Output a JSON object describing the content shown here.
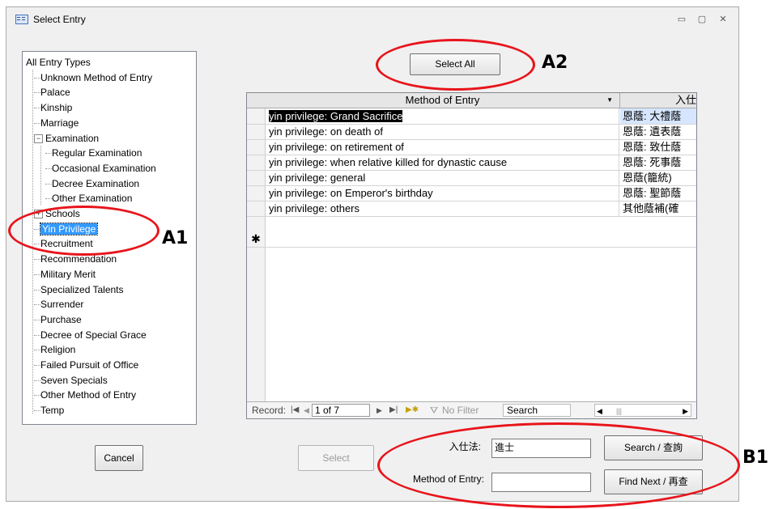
{
  "window": {
    "title": "Select Entry",
    "controls": {
      "minimize": "▭",
      "maximize": "▢",
      "close": "✕"
    }
  },
  "tree": {
    "items": [
      {
        "label": "All Entry Types",
        "level": 0,
        "expander": ""
      },
      {
        "label": "Unknown Method of Entry",
        "level": 1,
        "expander": ""
      },
      {
        "label": "Palace",
        "level": 1,
        "expander": ""
      },
      {
        "label": "Kinship",
        "level": 1,
        "expander": ""
      },
      {
        "label": "Marriage",
        "level": 1,
        "expander": ""
      },
      {
        "label": "Examination",
        "level": 1,
        "expander": "−"
      },
      {
        "label": "Regular Examination",
        "level": 2,
        "expander": ""
      },
      {
        "label": "Occasional Examination",
        "level": 2,
        "expander": ""
      },
      {
        "label": "Decree Examination",
        "level": 2,
        "expander": ""
      },
      {
        "label": "Other Examination",
        "level": 2,
        "expander": ""
      },
      {
        "label": "Schools",
        "level": 1,
        "expander": "+"
      },
      {
        "label": "Yin Privilege",
        "level": 1,
        "expander": "",
        "selected": true
      },
      {
        "label": "Recruitment",
        "level": 1,
        "expander": ""
      },
      {
        "label": "Recommendation",
        "level": 1,
        "expander": ""
      },
      {
        "label": "Military Merit",
        "level": 1,
        "expander": ""
      },
      {
        "label": "Specialized Talents",
        "level": 1,
        "expander": ""
      },
      {
        "label": "Surrender",
        "level": 1,
        "expander": ""
      },
      {
        "label": "Purchase",
        "level": 1,
        "expander": ""
      },
      {
        "label": "Decree of Special Grace",
        "level": 1,
        "expander": ""
      },
      {
        "label": "Religion",
        "level": 1,
        "expander": ""
      },
      {
        "label": "Failed Pursuit of Office",
        "level": 1,
        "expander": ""
      },
      {
        "label": "Seven Specials",
        "level": 1,
        "expander": ""
      },
      {
        "label": "Other Method of Entry",
        "level": 1,
        "expander": ""
      },
      {
        "label": "Temp",
        "level": 1,
        "expander": ""
      }
    ]
  },
  "buttons": {
    "select_all": "Select All",
    "cancel": "Cancel",
    "select": "Select",
    "search": "Search / 查詢",
    "find_next": "Find Next / 再查"
  },
  "grid": {
    "columns": [
      "Method of Entry",
      "入仕"
    ],
    "rows": [
      {
        "a": "yin privilege: Grand Sacrifice",
        "b": "恩蔭: 大禮蔭"
      },
      {
        "a": "yin privilege: on death of",
        "b": "恩蔭: 遺表蔭"
      },
      {
        "a": "yin privilege: on retirement of",
        "b": "恩蔭: 致仕蔭"
      },
      {
        "a": "yin privilege: when relative killed for dynastic cause",
        "b": "恩蔭: 死事蔭"
      },
      {
        "a": "yin privilege: general",
        "b": "恩蔭(籠統)"
      },
      {
        "a": "yin privilege: on Emperor's birthday",
        "b": "恩蔭: 聖節蔭"
      },
      {
        "a": "yin privilege: others",
        "b": "其他蔭補(確"
      }
    ],
    "new_row_marker": "✱",
    "nav": {
      "record_label": "Record:",
      "position": "1 of 7",
      "no_filter": "No Filter",
      "search": "Search"
    }
  },
  "search_form": {
    "chinese_label": "入仕法:",
    "chinese_value": "進士",
    "method_label": "Method of Entry:",
    "method_value": ""
  },
  "annotations": [
    "A1",
    "A2",
    "B1"
  ],
  "colors": {
    "annotation": "#e8141b",
    "selection": "#3399ff"
  }
}
